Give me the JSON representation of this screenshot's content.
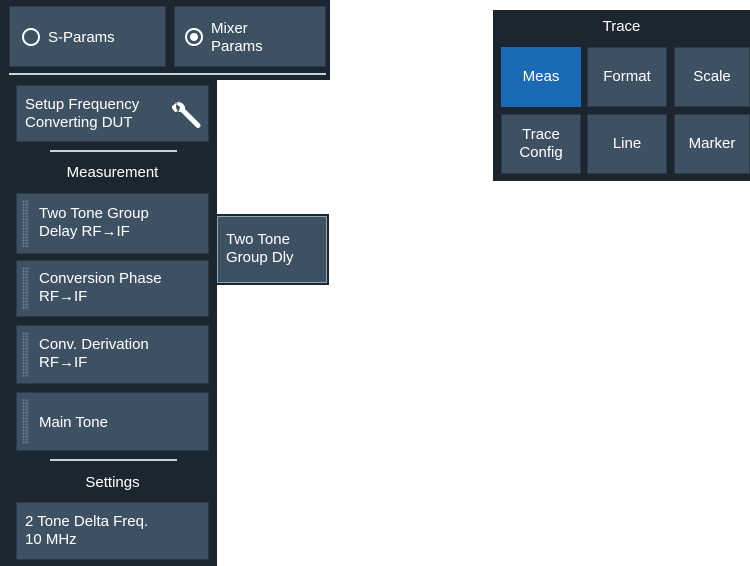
{
  "mode_selector": {
    "s_params_label": "S-Params",
    "mixer_params_label": "Mixer\nParams",
    "selected": "mixer_params"
  },
  "side_panel": {
    "setup_button_label": "Setup Frequency\nConverting DUT",
    "measurement_header": "Measurement",
    "measurements": [
      {
        "label": "Two Tone Group\nDelay RF→IF"
      },
      {
        "label": "Conversion Phase\nRF→IF"
      },
      {
        "label": "Conv. Derivation\nRF→IF"
      },
      {
        "label": "Main Tone"
      }
    ],
    "settings_header": "Settings",
    "settings_button_label": "2 Tone Delta Freq.\n10 MHz"
  },
  "submenu": {
    "label": "Two Tone\nGroup Dly"
  },
  "trace_panel": {
    "title": "Trace",
    "buttons": [
      {
        "label": "Meas",
        "active": true
      },
      {
        "label": "Format",
        "active": false
      },
      {
        "label": "Scale",
        "active": false
      },
      {
        "label": "Trace\nConfig",
        "active": false
      },
      {
        "label": "Line",
        "active": false
      },
      {
        "label": "Marker",
        "active": false
      }
    ]
  },
  "colors": {
    "active_button": "#1a6ab5",
    "button": "#3e5163",
    "panel": "#1c2631"
  }
}
